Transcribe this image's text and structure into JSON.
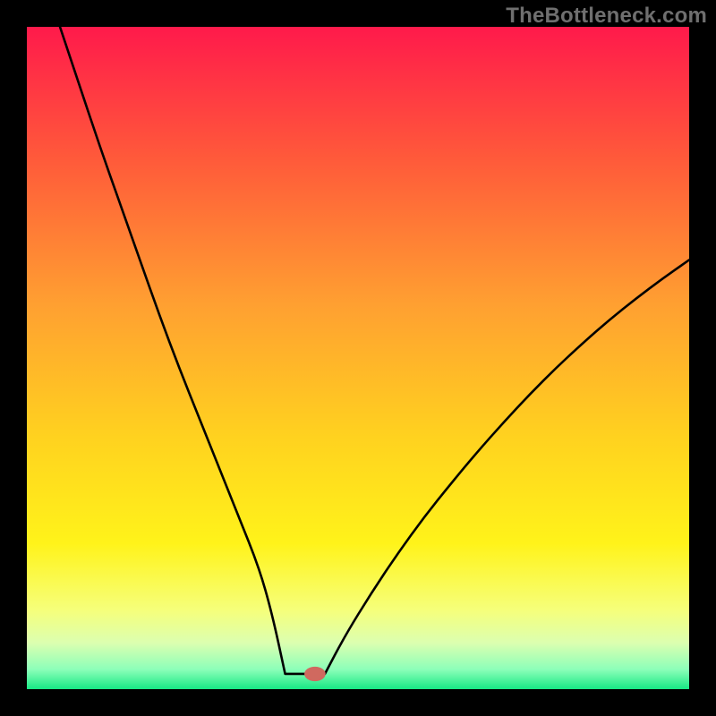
{
  "watermark": "TheBottleneck.com",
  "chart_data": {
    "type": "line",
    "title": "",
    "xlabel": "",
    "ylabel": "",
    "xlim": [
      0,
      100
    ],
    "ylim": [
      0,
      100
    ],
    "grid": false,
    "background_gradient_stops": [
      {
        "offset": 0,
        "color": "#ff1a4b"
      },
      {
        "offset": 20,
        "color": "#ff5a3a"
      },
      {
        "offset": 42,
        "color": "#ffa031"
      },
      {
        "offset": 62,
        "color": "#ffd21f"
      },
      {
        "offset": 78,
        "color": "#fff31a"
      },
      {
        "offset": 88,
        "color": "#f6ff7a"
      },
      {
        "offset": 93,
        "color": "#dcffb0"
      },
      {
        "offset": 97,
        "color": "#8dffb9"
      },
      {
        "offset": 100,
        "color": "#17e884"
      }
    ],
    "curve_vertex_x": 42,
    "flat_bottom_start_x": 39,
    "flat_bottom_end_x": 45,
    "flat_bottom_y": 2.3,
    "marker": {
      "x": 43.5,
      "y": 2.3,
      "rx": 1.6,
      "ry": 1.1,
      "color": "#d0695f"
    },
    "series": [
      {
        "name": "left-branch",
        "x": [
          5,
          8,
          11,
          14,
          17,
          20,
          23,
          26,
          29,
          32,
          35,
          37,
          39
        ],
        "y": [
          100,
          91,
          82,
          73.5,
          65,
          56.5,
          48.5,
          41,
          33.5,
          26,
          18.5,
          11.5,
          2.3
        ]
      },
      {
        "name": "right-branch",
        "x": [
          45,
          48,
          52,
          56,
          60,
          64,
          68,
          72,
          76,
          80,
          84,
          88,
          92,
          96,
          100
        ],
        "y": [
          2.3,
          8,
          14.5,
          20.5,
          26,
          31,
          35.8,
          40.3,
          44.6,
          48.6,
          52.3,
          55.8,
          59,
          62,
          64.8
        ]
      }
    ]
  }
}
